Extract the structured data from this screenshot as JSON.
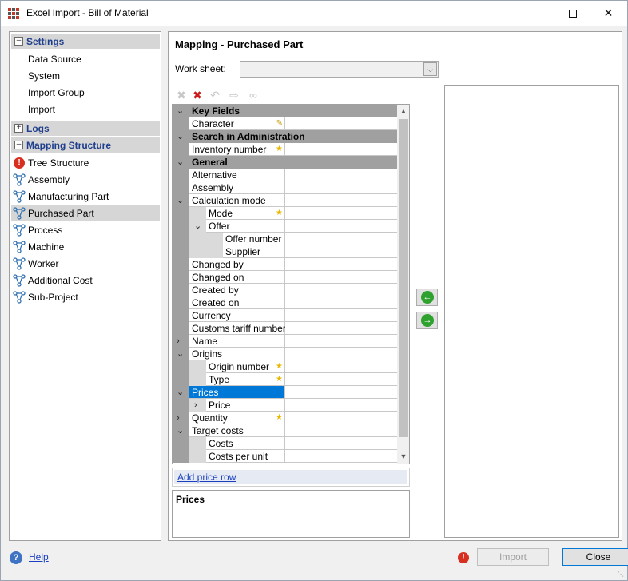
{
  "window": {
    "title": "Excel Import - Bill of Material"
  },
  "nav": {
    "settings": {
      "label": "Settings",
      "items": [
        "Data Source",
        "System",
        "Import Group",
        "Import"
      ]
    },
    "logs": {
      "label": "Logs"
    },
    "mapping": {
      "label": "Mapping Structure",
      "items": [
        {
          "label": "Tree Structure",
          "icon": "error-icon"
        },
        {
          "label": "Assembly",
          "icon": "structure-icon"
        },
        {
          "label": "Manufacturing Part",
          "icon": "structure-icon"
        },
        {
          "label": "Purchased Part",
          "icon": "structure-icon",
          "selected": true
        },
        {
          "label": "Process",
          "icon": "structure-icon"
        },
        {
          "label": "Machine",
          "icon": "structure-icon"
        },
        {
          "label": "Worker",
          "icon": "structure-icon"
        },
        {
          "label": "Additional Cost",
          "icon": "structure-icon"
        },
        {
          "label": "Sub-Project",
          "icon": "structure-icon"
        }
      ]
    }
  },
  "main": {
    "title": "Mapping - Purchased Part",
    "worksheet_label": "Work sheet:",
    "worksheet_value": ""
  },
  "grid": {
    "rows": [
      {
        "kind": "cat",
        "label": "Key Fields"
      },
      {
        "kind": "field",
        "label": "Character",
        "level": 0,
        "mark": "pen"
      },
      {
        "kind": "cat",
        "label": "Search in Administration"
      },
      {
        "kind": "field",
        "label": "Inventory number",
        "level": 0,
        "mark": "star"
      },
      {
        "kind": "cat",
        "label": "General"
      },
      {
        "kind": "field",
        "label": "Alternative",
        "level": 0
      },
      {
        "kind": "field",
        "label": "Assembly",
        "level": 0
      },
      {
        "kind": "field",
        "label": "Calculation mode",
        "level": 0,
        "expander": "open"
      },
      {
        "kind": "field",
        "label": "Mode",
        "level": 1,
        "mark": "star"
      },
      {
        "kind": "field",
        "label": "Offer",
        "level": 1,
        "expander": "open"
      },
      {
        "kind": "field",
        "label": "Offer number",
        "level": 2
      },
      {
        "kind": "field",
        "label": "Supplier",
        "level": 2
      },
      {
        "kind": "field",
        "label": "Changed by",
        "level": 0
      },
      {
        "kind": "field",
        "label": "Changed on",
        "level": 0
      },
      {
        "kind": "field",
        "label": "Created by",
        "level": 0
      },
      {
        "kind": "field",
        "label": "Created on",
        "level": 0
      },
      {
        "kind": "field",
        "label": "Currency",
        "level": 0
      },
      {
        "kind": "field",
        "label": "Customs tariff number",
        "level": 0
      },
      {
        "kind": "field",
        "label": "Name",
        "level": 0,
        "expander": "closed"
      },
      {
        "kind": "field",
        "label": "Origins",
        "level": 0,
        "expander": "open"
      },
      {
        "kind": "field",
        "label": "Origin number",
        "level": 1,
        "mark": "star"
      },
      {
        "kind": "field",
        "label": "Type",
        "level": 1,
        "mark": "star"
      },
      {
        "kind": "field",
        "label": "Prices",
        "level": 0,
        "expander": "open",
        "selected": true
      },
      {
        "kind": "field",
        "label": "Price",
        "level": 1,
        "expander": "closed"
      },
      {
        "kind": "field",
        "label": "Quantity",
        "level": 0,
        "expander": "closed",
        "mark": "star"
      },
      {
        "kind": "field",
        "label": "Target costs",
        "level": 0,
        "expander": "open"
      },
      {
        "kind": "field",
        "label": "Costs",
        "level": 1
      },
      {
        "kind": "field",
        "label": "Costs per unit",
        "level": 1
      }
    ]
  },
  "add_price_row": "Add price row",
  "description_title": "Prices",
  "footer": {
    "help": "Help",
    "import": "Import",
    "close": "Close"
  },
  "colors": {
    "accent": "#0078d7",
    "section_text": "#1f3e8c",
    "category_bg": "#a0a0a0"
  }
}
